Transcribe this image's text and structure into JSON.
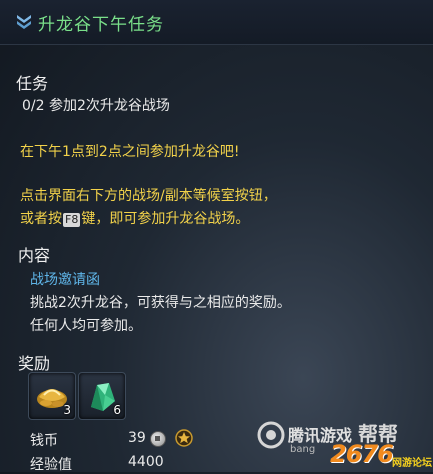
{
  "title": "升龙谷下午任务",
  "task": {
    "heading": "任务",
    "objective": "0/2 参加2次升龙谷战场"
  },
  "notes": {
    "line1": "在下午1点到2点之间参加升龙谷吧!",
    "line2": "点击界面右下方的战场/副本等候室按钮，",
    "line3_prefix": "或者按",
    "line3_key": "F8",
    "line3_suffix": "键，即可参加升龙谷战场。"
  },
  "content": {
    "heading": "内容",
    "link": "战场邀请函",
    "line1": "挑战2次升龙谷，可获得与之相应的奖励。",
    "line2": "任何人均可参加。"
  },
  "rewards": {
    "heading": "奖励",
    "items": [
      {
        "icon": "gold-ingot-icon",
        "count": "3"
      },
      {
        "icon": "green-crystal-icon",
        "count": "6"
      }
    ],
    "money_label": "钱币",
    "money_value": "39",
    "exp_label": "经验值",
    "exp_value": "4400"
  },
  "watermark": {
    "brand": "腾讯游戏",
    "suffix": "帮帮",
    "sub": "bang",
    "logo": "2676",
    "logo_sub": "网游论坛"
  },
  "colors": {
    "title": "#7ae08a",
    "highlight": "#f2d24a",
    "link": "#5fb5e8"
  }
}
